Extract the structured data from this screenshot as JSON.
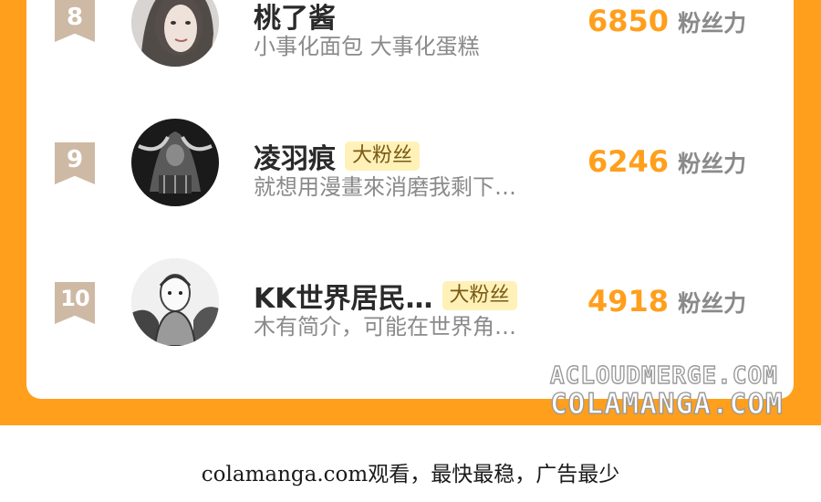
{
  "ranking": [
    {
      "rank": "8",
      "name": "桃了酱",
      "badge": "",
      "bio": "小事化面包 大事化蛋糕",
      "score": "6850",
      "unit": "粉丝力"
    },
    {
      "rank": "9",
      "name": "凌羽痕",
      "badge": "大粉丝",
      "bio": "就想用漫畫來消磨我剩下…",
      "score": "6246",
      "unit": "粉丝力"
    },
    {
      "rank": "10",
      "name": "KK世界居民…",
      "badge": "大粉丝",
      "bio": "木有简介，可能在世界角…",
      "score": "4918",
      "unit": "粉丝力"
    }
  ],
  "watermark": {
    "line1": "ACLOUDMERGE.COM",
    "line2": "COLAMANGA.COM"
  },
  "footer": {
    "note": "colamanga.com观看，最快最稳，广告最少"
  },
  "colors": {
    "accent": "#ff9f1c",
    "badge_bg": "#fff1b8",
    "rank_badge": "#ceb9a4"
  }
}
